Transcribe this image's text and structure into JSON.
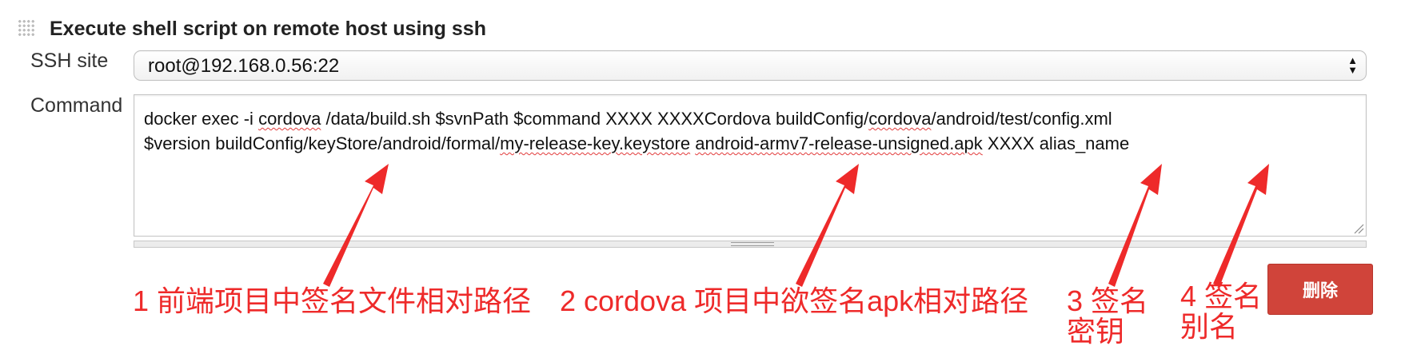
{
  "section": {
    "title": "Execute shell script on remote host using ssh"
  },
  "ssh_site": {
    "label": "SSH site",
    "selected": "root@192.168.0.56:22"
  },
  "command": {
    "label": "Command",
    "segments": [
      {
        "text": "docker exec -i ",
        "flagged": false
      },
      {
        "text": "cordova",
        "flagged": true
      },
      {
        "text": " /data/build.sh $svnPath $command XXXX XXXXCordova buildConfig/",
        "flagged": false
      },
      {
        "text": "cordova",
        "flagged": true
      },
      {
        "text": "/android/test/config.xml\n$version buildConfig/keyStore/android/formal/",
        "flagged": false
      },
      {
        "text": "my-release-key.keystore",
        "flagged": true
      },
      {
        "text": " ",
        "flagged": false
      },
      {
        "text": "android-armv7-release-unsigned.apk",
        "flagged": true
      },
      {
        "text": " XXXX alias_name",
        "flagged": false
      }
    ]
  },
  "buttons": {
    "delete_label": "删除"
  },
  "annotations": {
    "a1": "1 前端项目中签名文件相对路径",
    "a2": "2 cordova 项目中欲签名apk相对路径",
    "a3_line1": "3 签名",
    "a3_line2": "密钥",
    "a4_line1": "4 签名",
    "a4_line2": "别名"
  },
  "colors": {
    "annotation_red": "#ee2a2a",
    "delete_button": "#d0443a"
  }
}
